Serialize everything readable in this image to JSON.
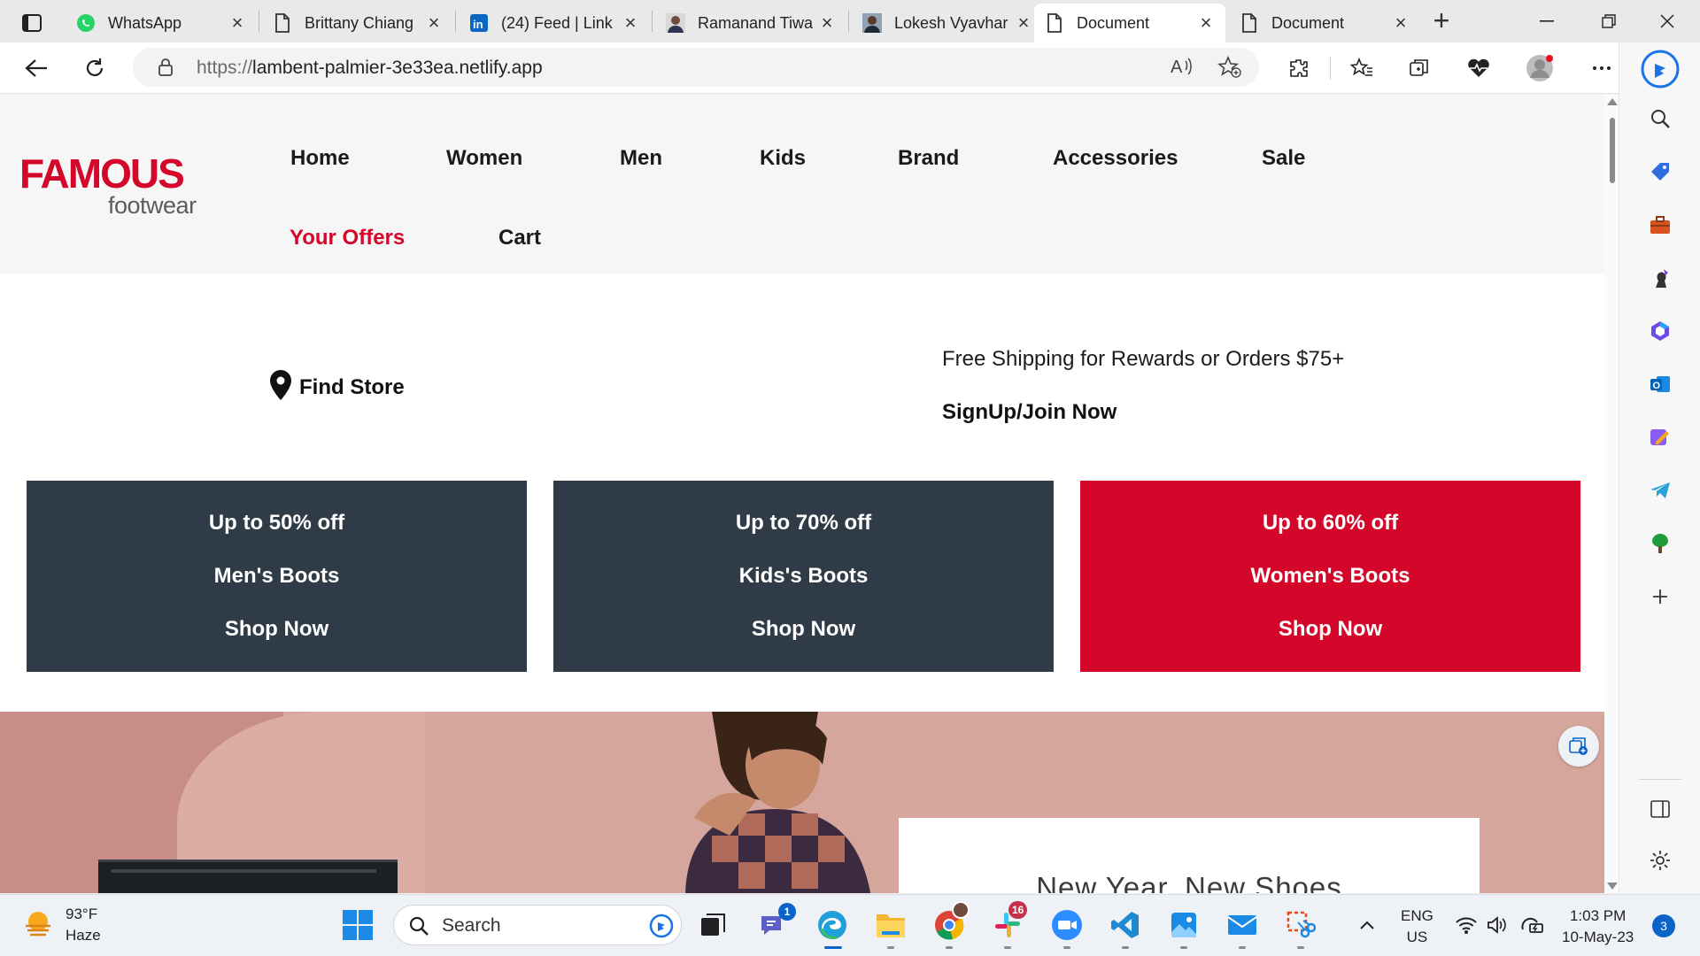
{
  "browser": {
    "tabs": [
      {
        "title": "WhatsApp",
        "icon": "whatsapp-icon",
        "active": false
      },
      {
        "title": "Brittany Chiang",
        "icon": "document-icon",
        "active": false
      },
      {
        "title": "(24) Feed | Link",
        "icon": "linkedin-icon",
        "active": false
      },
      {
        "title": "Ramanand Tiwa",
        "icon": "profile-photo-icon",
        "active": false
      },
      {
        "title": "Lokesh Vyavhar",
        "icon": "profile-photo-icon",
        "active": false
      },
      {
        "title": "Document",
        "icon": "document-icon",
        "active": true
      },
      {
        "title": "Document",
        "icon": "document-icon",
        "active": false
      }
    ],
    "address": {
      "protocol": "https://",
      "host": "lambent-palmier-3e33ea.netlify.app"
    }
  },
  "site": {
    "logo": {
      "line1": "FAMOUS",
      "line2": "footwear"
    },
    "nav": {
      "home": "Home",
      "women": "Women",
      "men": "Men",
      "kids": "Kids",
      "brand": "Brand",
      "accessories": "Accessories",
      "sale": "Sale",
      "offers": "Your Offers",
      "cart": "Cart"
    },
    "find_store": "Find Store",
    "shipping": "Free Shipping for Rewards or Orders $75+",
    "signup": "SignUp/Join Now",
    "promos": [
      {
        "discount": "Up to 50% off",
        "category": "Men's Boots",
        "cta": "Shop Now",
        "color": "#2f3b46"
      },
      {
        "discount": "Up to 70% off",
        "category": "Kids's Boots",
        "cta": "Shop Now",
        "color": "#2f3b46"
      },
      {
        "discount": "Up to 60% off",
        "category": "Women's Boots",
        "cta": "Shop Now",
        "color": "#d4072b"
      }
    ],
    "hero_headline": "New Year, New Shoes"
  },
  "taskbar": {
    "weather": {
      "temp": "93°F",
      "condition": "Haze"
    },
    "search_label": "Search",
    "teams_badge": "1",
    "slack_badge": "16",
    "lang": {
      "line1": "ENG",
      "line2": "US"
    },
    "clock": {
      "time": "1:03 PM",
      "date": "10-May-23"
    },
    "notifications": "3"
  },
  "colors": {
    "brand_red": "#d4072b",
    "promo_dark": "#2f3b46",
    "accent_blue": "#0a63c9"
  }
}
